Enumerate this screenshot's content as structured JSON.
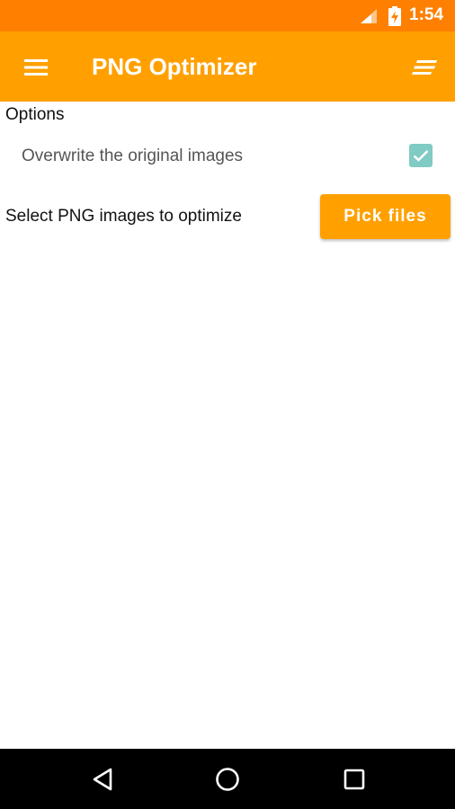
{
  "status_bar": {
    "time": "1:54",
    "icons": [
      "signal-icon",
      "battery-charging-icon"
    ],
    "color": "#FF8000"
  },
  "app_bar": {
    "title": "PNG Optimizer",
    "left_icon": "hamburger-menu-icon",
    "right_icon": "sort-icon",
    "color": "#FFA000"
  },
  "options": {
    "heading": "Options",
    "overwrite": {
      "label": "Overwrite the original images",
      "checked": true,
      "checkbox_color": "#80CBC4"
    }
  },
  "pick": {
    "label": "Select PNG images to optimize",
    "button_label": "Pick files"
  },
  "nav_bar": {
    "buttons": [
      "back-icon",
      "home-icon",
      "recents-icon"
    ]
  }
}
